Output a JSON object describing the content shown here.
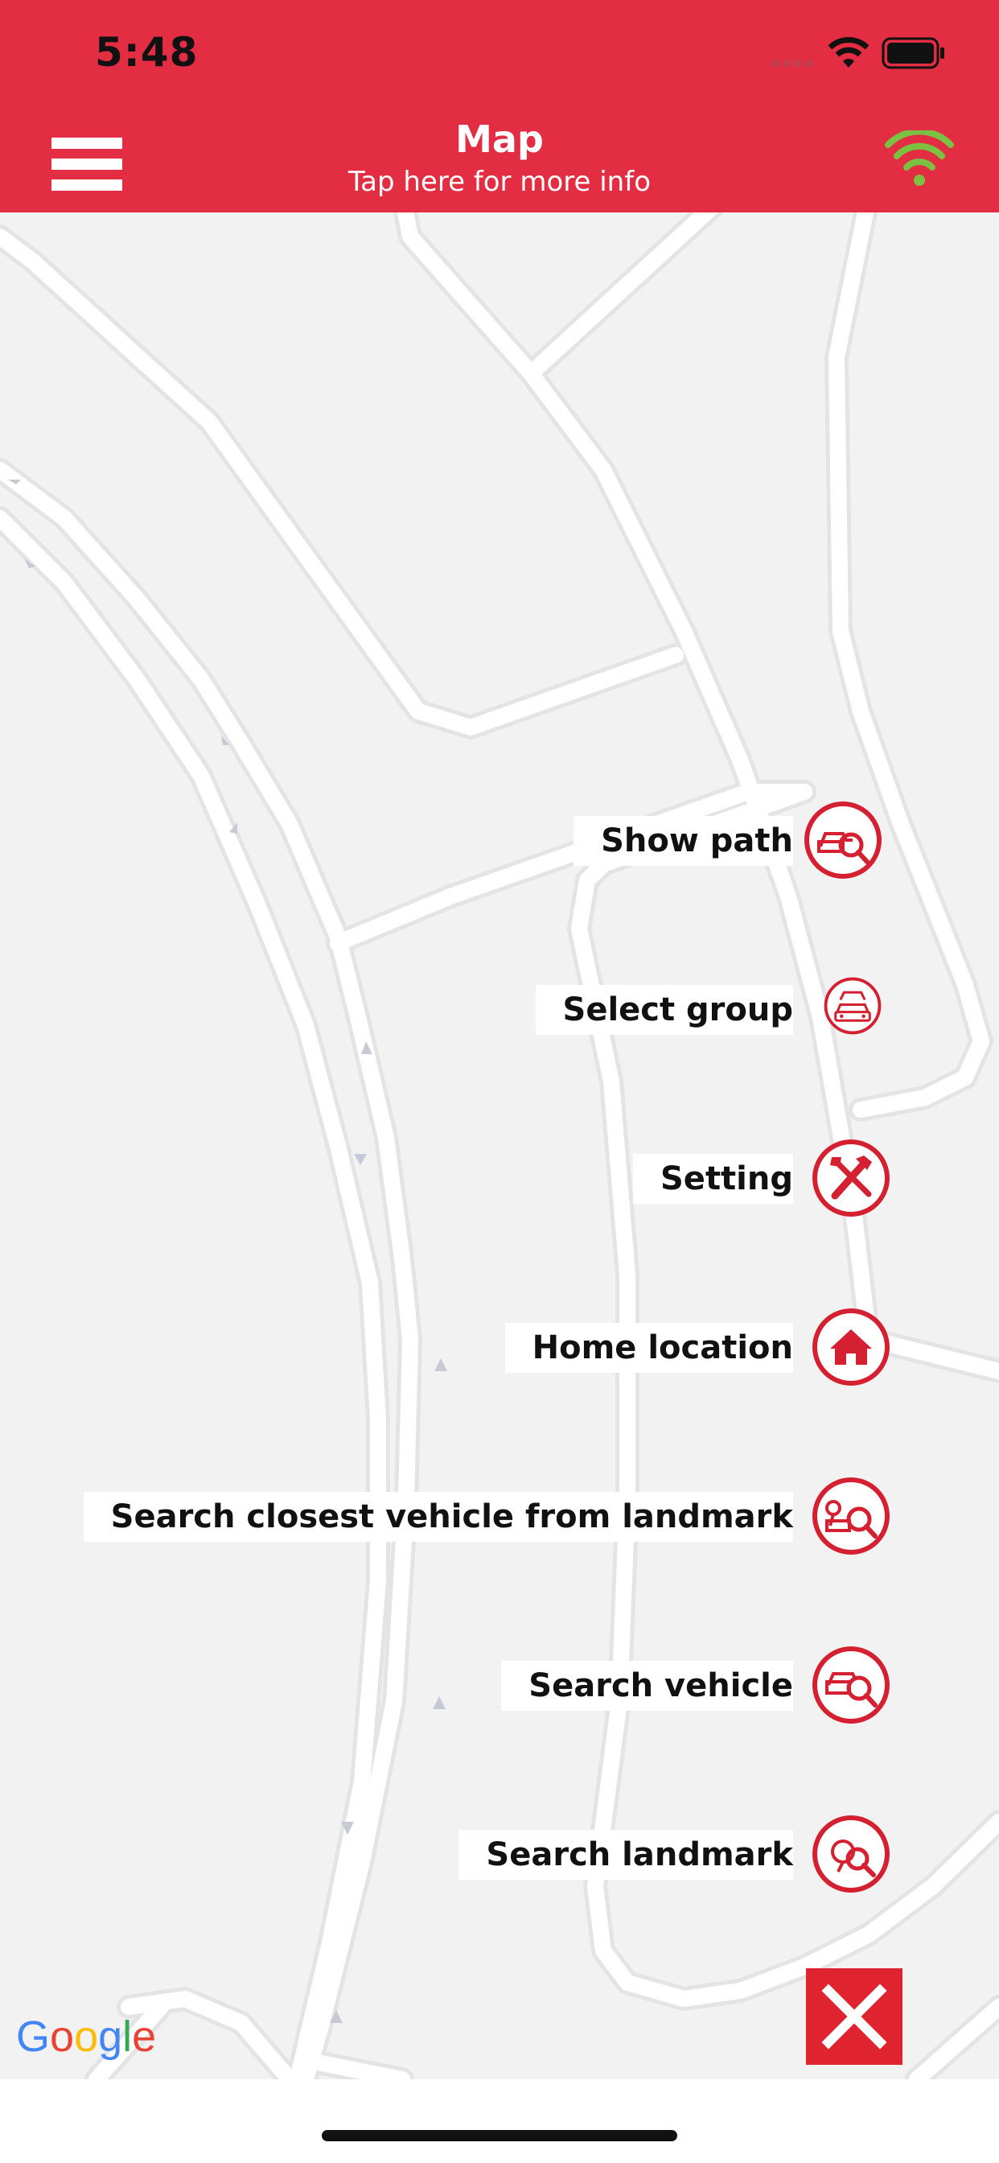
{
  "status_bar": {
    "time": "5:48"
  },
  "nav": {
    "title": "Map",
    "subtitle": "Tap here for more info",
    "menu_icon": "hamburger-menu-icon",
    "connection_icon": "wifi-connected-icon",
    "connection_color": "#7cc242"
  },
  "theme": {
    "brand_red": "#e22d42",
    "icon_red": "#d42030"
  },
  "fab_menu": [
    {
      "label": "Show path",
      "icon": "car-search-icon"
    },
    {
      "label": "Select group",
      "icon": "car-group-icon"
    },
    {
      "label": "Setting",
      "icon": "tools-icon"
    },
    {
      "label": "Home location",
      "icon": "home-icon"
    },
    {
      "label": "Search closest vehicle from landmark",
      "icon": "landmark-car-search-icon"
    },
    {
      "label": "Search vehicle",
      "icon": "car-search-icon"
    },
    {
      "label": "Search landmark",
      "icon": "landmark-search-icon"
    }
  ],
  "close_button": {
    "icon": "close-icon"
  },
  "map": {
    "attribution": "Google"
  }
}
